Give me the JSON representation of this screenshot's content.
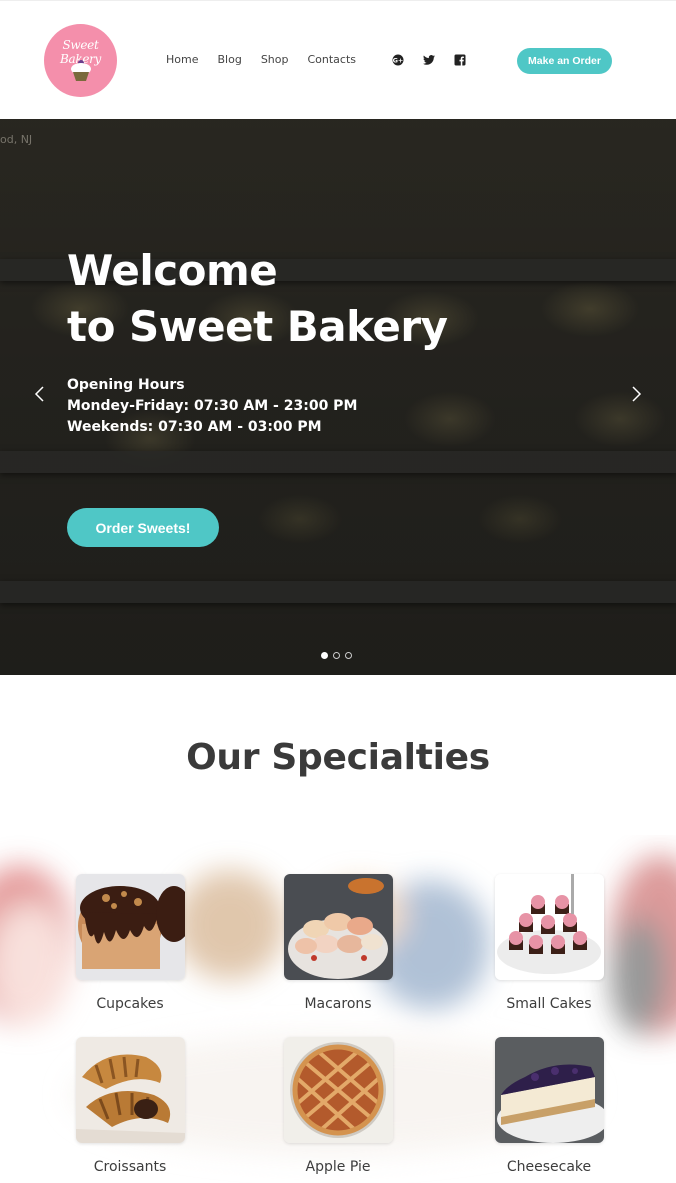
{
  "header": {
    "logo_text": "Sweet Bakery",
    "nav": [
      "Home",
      "Blog",
      "Shop",
      "Contacts"
    ],
    "social_icons": [
      "google-plus-icon",
      "twitter-icon",
      "facebook-icon"
    ],
    "order_button": "Make an Order"
  },
  "hero": {
    "corner_text": "od, NJ",
    "title_line1": "Welcome",
    "title_line2": "to Sweet Bakery",
    "hours_title": "Opening Hours",
    "hours_weekdays": "Mondey-Friday: 07:30 AM - 23:00 PM",
    "hours_weekends": "Weekends: 07:30 AM - 03:00 PM",
    "cta": "Order Sweets!",
    "slides": 3,
    "active_slide": 1
  },
  "specialties": {
    "title": "Our Specialties",
    "items": [
      {
        "label": "Cupcakes"
      },
      {
        "label": "Macarons"
      },
      {
        "label": "Small Cakes"
      },
      {
        "label": "Croissants"
      },
      {
        "label": "Apple Pie"
      },
      {
        "label": "Cheesecake"
      }
    ]
  },
  "colors": {
    "accent": "#4fc7c6",
    "logo_pink": "#f48fab",
    "text_dark": "#3a3a3a"
  }
}
